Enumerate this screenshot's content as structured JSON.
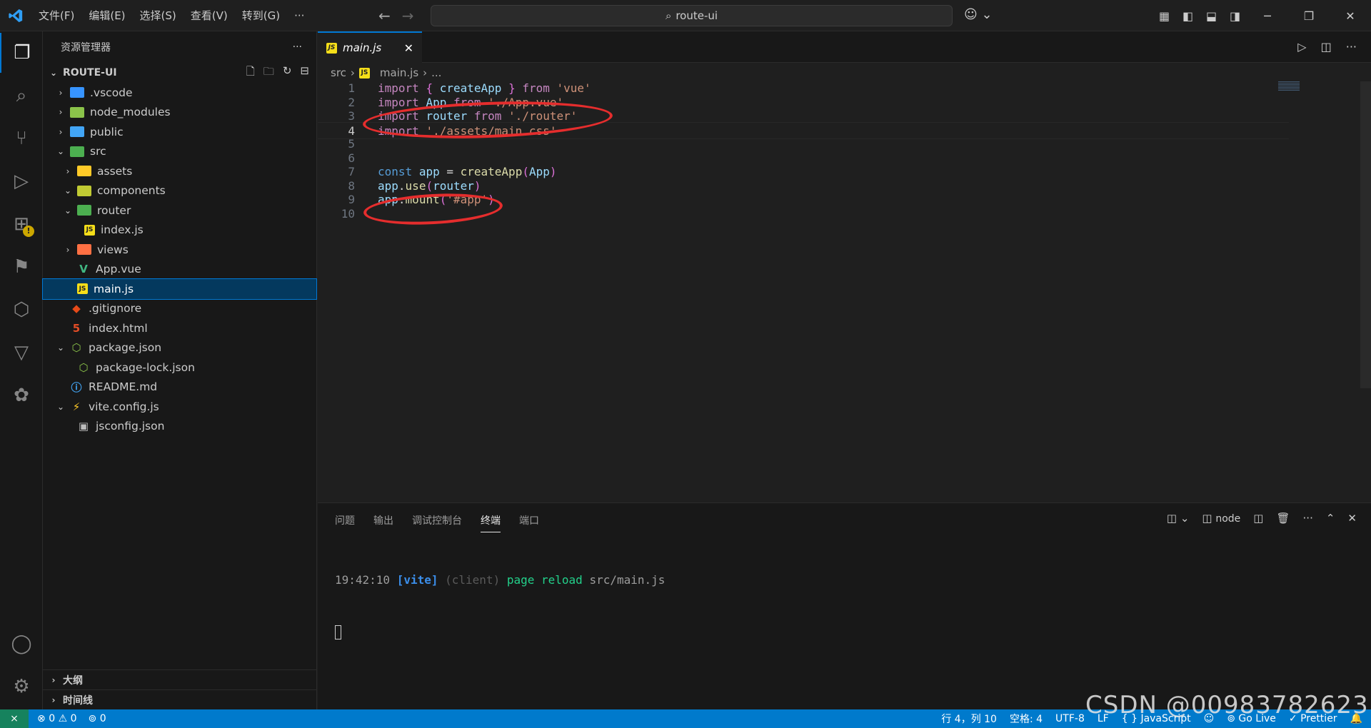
{
  "menu": [
    "文件(F)",
    "编辑(E)",
    "选择(S)",
    "查看(V)",
    "转到(G)",
    "···"
  ],
  "search": {
    "text": "route-ui"
  },
  "sidebar": {
    "title": "资源管理器",
    "more": "···",
    "root": "ROUTE-UI",
    "items": [
      {
        "label": ".vscode",
        "twisty": "›",
        "depth": 1,
        "icon": "folder-vscode",
        "color": "#3794ff"
      },
      {
        "label": "node_modules",
        "twisty": "›",
        "depth": 1,
        "icon": "folder-node",
        "color": "#8bc34a"
      },
      {
        "label": "public",
        "twisty": "›",
        "depth": 1,
        "icon": "folder-public",
        "color": "#42a5f5"
      },
      {
        "label": "src",
        "twisty": "⌄",
        "depth": 1,
        "icon": "folder-src",
        "color": "#4caf50"
      },
      {
        "label": "assets",
        "twisty": "›",
        "depth": 2,
        "icon": "folder-assets",
        "color": "#ffca28"
      },
      {
        "label": "components",
        "twisty": "⌄",
        "depth": 2,
        "icon": "folder-components",
        "color": "#c0ca33"
      },
      {
        "label": "router",
        "twisty": "⌄",
        "depth": 2,
        "icon": "folder-router",
        "color": "#4caf50"
      },
      {
        "label": "index.js",
        "twisty": "",
        "depth": 3,
        "icon": "js-icon",
        "color": "#f5de19"
      },
      {
        "label": "views",
        "twisty": "›",
        "depth": 2,
        "icon": "folder-views",
        "color": "#ff7043"
      },
      {
        "label": "App.vue",
        "twisty": "",
        "depth": 2,
        "icon": "vue-icon",
        "color": "#41b883"
      },
      {
        "label": "main.js",
        "twisty": "",
        "depth": 2,
        "icon": "js-icon",
        "color": "#f5de19",
        "selected": true
      },
      {
        "label": ".gitignore",
        "twisty": "",
        "depth": 1,
        "icon": "git-icon",
        "color": "#e64a19"
      },
      {
        "label": "index.html",
        "twisty": "",
        "depth": 1,
        "icon": "html-icon",
        "color": "#e44d26"
      },
      {
        "label": "package.json",
        "twisty": "⌄",
        "depth": 1,
        "icon": "nodejs-icon",
        "color": "#8bc34a"
      },
      {
        "label": "package-lock.json",
        "twisty": "",
        "depth": 2,
        "icon": "nodejs-icon",
        "color": "#8bc34a"
      },
      {
        "label": "README.md",
        "twisty": "",
        "depth": 1,
        "icon": "info-icon",
        "color": "#42a5f5"
      },
      {
        "label": "vite.config.js",
        "twisty": "⌄",
        "depth": 1,
        "icon": "vite-icon",
        "color": "#ffca28"
      },
      {
        "label": "jsconfig.json",
        "twisty": "",
        "depth": 2,
        "icon": "jsconfig-icon",
        "color": "#bbbbbb"
      }
    ],
    "outline": "大纲",
    "timeline": "时间线"
  },
  "tab": {
    "label": "main.js",
    "close": "✕",
    "icon_text": "JS"
  },
  "breadcrumb": {
    "src": "src",
    "sep": "›",
    "file": "main.js",
    "tail": "..."
  },
  "editor": {
    "lines": [
      {
        "n": "1",
        "tokens": [
          [
            "kw2",
            "import"
          ],
          [
            "pl",
            " "
          ],
          [
            "br",
            "{"
          ],
          [
            "pl",
            " "
          ],
          [
            "var",
            "createApp"
          ],
          [
            "pl",
            " "
          ],
          [
            "br",
            "}"
          ],
          [
            "pl",
            " "
          ],
          [
            "kw2",
            "from"
          ],
          [
            "pl",
            " "
          ],
          [
            "str",
            "'vue'"
          ]
        ]
      },
      {
        "n": "2",
        "tokens": [
          [
            "kw2",
            "import"
          ],
          [
            "pl",
            " "
          ],
          [
            "var",
            "App"
          ],
          [
            "pl",
            " "
          ],
          [
            "kw2",
            "from"
          ],
          [
            "pl",
            " "
          ],
          [
            "str",
            "'./App.vue'"
          ]
        ]
      },
      {
        "n": "3",
        "tokens": [
          [
            "kw2",
            "import"
          ],
          [
            "pl",
            " "
          ],
          [
            "var",
            "router"
          ],
          [
            "pl",
            " "
          ],
          [
            "kw2",
            "from"
          ],
          [
            "pl",
            " "
          ],
          [
            "str",
            "'./router'"
          ]
        ]
      },
      {
        "n": "4",
        "tokens": [
          [
            "kw2",
            "import"
          ],
          [
            "pl",
            " "
          ],
          [
            "str",
            "'./assets/main.css'"
          ]
        ]
      },
      {
        "n": "5",
        "tokens": []
      },
      {
        "n": "6",
        "tokens": []
      },
      {
        "n": "7",
        "tokens": [
          [
            "kw",
            "const"
          ],
          [
            "pl",
            " "
          ],
          [
            "var",
            "app"
          ],
          [
            "pl",
            " = "
          ],
          [
            "fn",
            "createApp"
          ],
          [
            "br",
            "("
          ],
          [
            "var",
            "App"
          ],
          [
            "br",
            ")"
          ]
        ]
      },
      {
        "n": "8",
        "tokens": [
          [
            "var",
            "app"
          ],
          [
            "pl",
            "."
          ],
          [
            "fn",
            "use"
          ],
          [
            "br",
            "("
          ],
          [
            "var",
            "router"
          ],
          [
            "br",
            ")"
          ]
        ]
      },
      {
        "n": "9",
        "tokens": [
          [
            "var",
            "app"
          ],
          [
            "pl",
            "."
          ],
          [
            "fn",
            "mount"
          ],
          [
            "br",
            "("
          ],
          [
            "str",
            "'#app'"
          ],
          [
            "br",
            ")"
          ]
        ]
      },
      {
        "n": "10",
        "tokens": []
      }
    ]
  },
  "panel": {
    "tabs": [
      "问题",
      "输出",
      "调试控制台",
      "终端",
      "端口"
    ],
    "active": "终端",
    "shell": "node",
    "terminal": {
      "time": "19:42:10",
      "tag": "[vite]",
      "client": "(client)",
      "msg": "page reload",
      "path": "src/main.js"
    }
  },
  "status": {
    "errors": "0",
    "warnings": "0",
    "ports": "0",
    "position": "行 4，列 10",
    "spaces": "空格: 4",
    "encoding": "UTF-8",
    "eol": "LF",
    "language": "JavaScript",
    "golive": "Go Live",
    "prettier": "Prettier"
  },
  "watermark": "CSDN @00983782623",
  "colors": {
    "accent": "#0078d4",
    "statusbar": "#007acc",
    "annotation": "#e52d2d"
  }
}
